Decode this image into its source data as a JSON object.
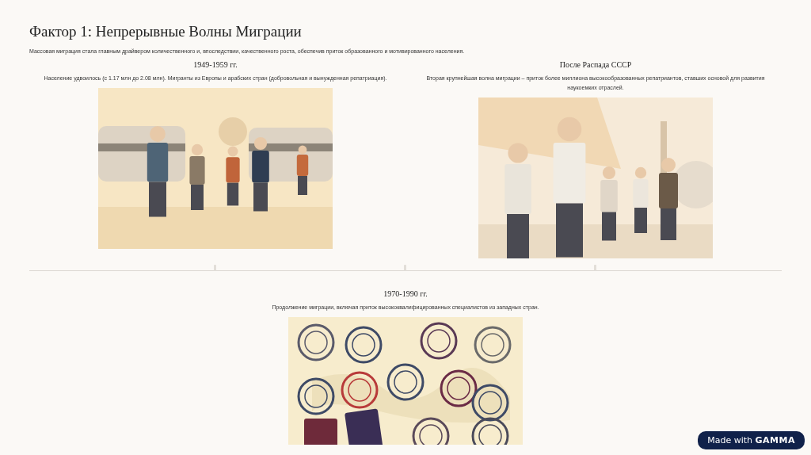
{
  "title": "Фактор 1: Непрерывные Волны Миграции",
  "intro": "Массовая миграция стала главным драйвером количественного и, впоследствии, качественного роста, обеспечив приток образованного и мотивированного населения.",
  "waves": [
    {
      "heading": "1949-1959 гг.",
      "text": "Население удвоилось (с 1.17 млн до 2.08 млн). Мигранты из Европы и арабских стран (добровольная и вынужденная репатриация)."
    },
    {
      "heading": "После Распада СССР",
      "text": "Вторая крупнейшая волна миграции – приток более миллиона высокообразованных репатриантов, ставших основой для развития наукоемких отраслей."
    },
    {
      "heading": "1970-1990 гг.",
      "text": "Продолжение миграции, включая приток высококвалифицированных специалистов из западных стран."
    }
  ],
  "badge": "Made with **GAMMA**"
}
